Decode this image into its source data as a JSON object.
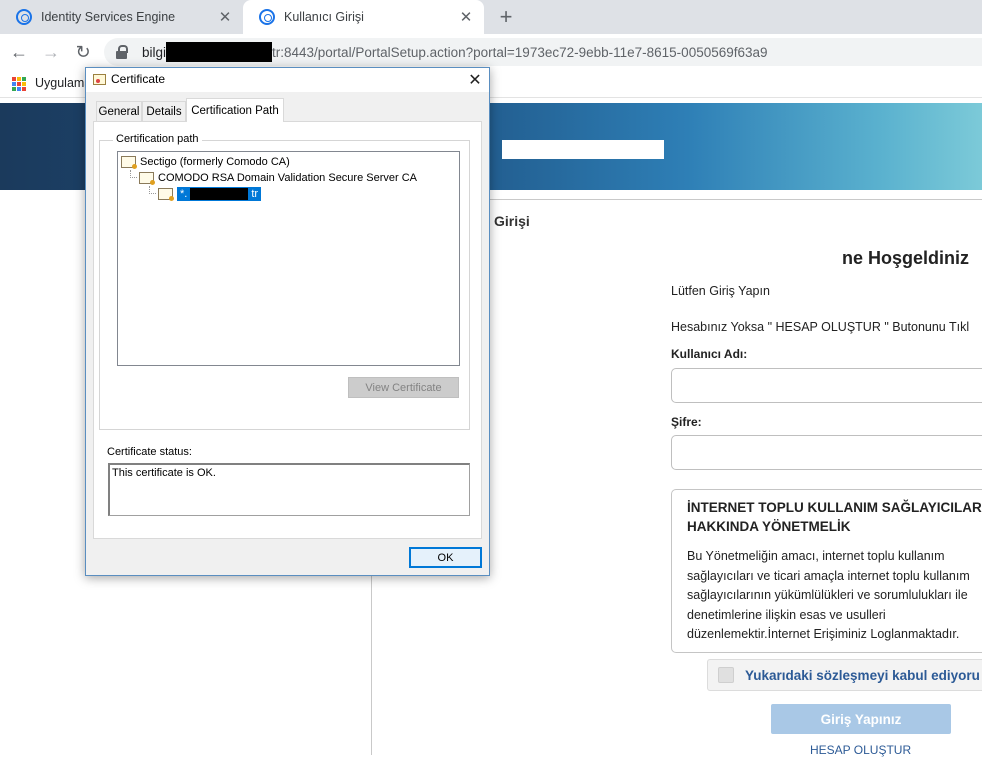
{
  "browser": {
    "tabs": [
      {
        "title": "Identity Services Engine",
        "active": false
      },
      {
        "title": "Kullanıcı Girişi",
        "active": true
      }
    ],
    "new_tab_symbol": "+",
    "close_symbol": "✕",
    "back_symbol": "←",
    "forward_symbol": "→",
    "reload_symbol": "↻",
    "url_prefix": "bilgi",
    "url_suffix": "tr:8443/portal/PortalSetup.action?portal=1973ec72-9ebb-11e7-8615-0050569f63a9",
    "bookmarks_label": "Uygulama",
    "apps_colors": [
      "#ea4335",
      "#fbbc05",
      "#34a853",
      "#4285f4",
      "#ea4335",
      "#fbbc05",
      "#34a853",
      "#4285f4",
      "#ea4335"
    ]
  },
  "page": {
    "section_heading": "Girişi",
    "welcome": "ne Hoşgeldiniz",
    "login_prompt": "Lütfen Giriş Yapın",
    "signup_hint": "Hesabınız Yoksa \" HESAP OLUŞTUR \" Butonunu Tıkl",
    "username_label": "Kullanıcı Adı:",
    "password_label": "Şifre:",
    "terms_title": "İNTERNET TOPLU KULLANIM SAĞLAYICILARI HAKKINDA YÖNETMELİK",
    "terms_body": "Bu Yönetmeliğin amacı, internet toplu kullanım\nsağlayıcıları ve ticari amaçla internet toplu kullanım\nsağlayıcılarının yükümlülükleri ve sorumlulukları ile\ndenetimlerine ilişkin esas ve usulleri\ndüzenlemektir.İnternet Erişiminiz Loglanmaktadır.",
    "agree_label": "Yukarıdaki sözleşmeyi kabul ediyoru",
    "login_button": "Giriş Yapınız",
    "signup_link": "HESAP OLUŞTUR",
    "colors": {
      "link": "#2c5a96",
      "button": "#a9c8e6"
    }
  },
  "dialog": {
    "title": "Certificate",
    "close_symbol": "✕",
    "tabs": [
      "General",
      "Details",
      "Certification Path"
    ],
    "selected_tab": "Certification Path",
    "group_label": "Certification path",
    "tree": [
      {
        "label": "Sectigo (formerly Comodo CA)"
      },
      {
        "label": "COMODO RSA Domain Validation Secure Server CA"
      },
      {
        "label_prefix": "*.",
        "label_suffix": "tr",
        "selected": true
      }
    ],
    "view_certificate_button": "View Certificate",
    "status_label": "Certificate status:",
    "status_text": "This certificate is OK.",
    "ok_button": "OK"
  }
}
